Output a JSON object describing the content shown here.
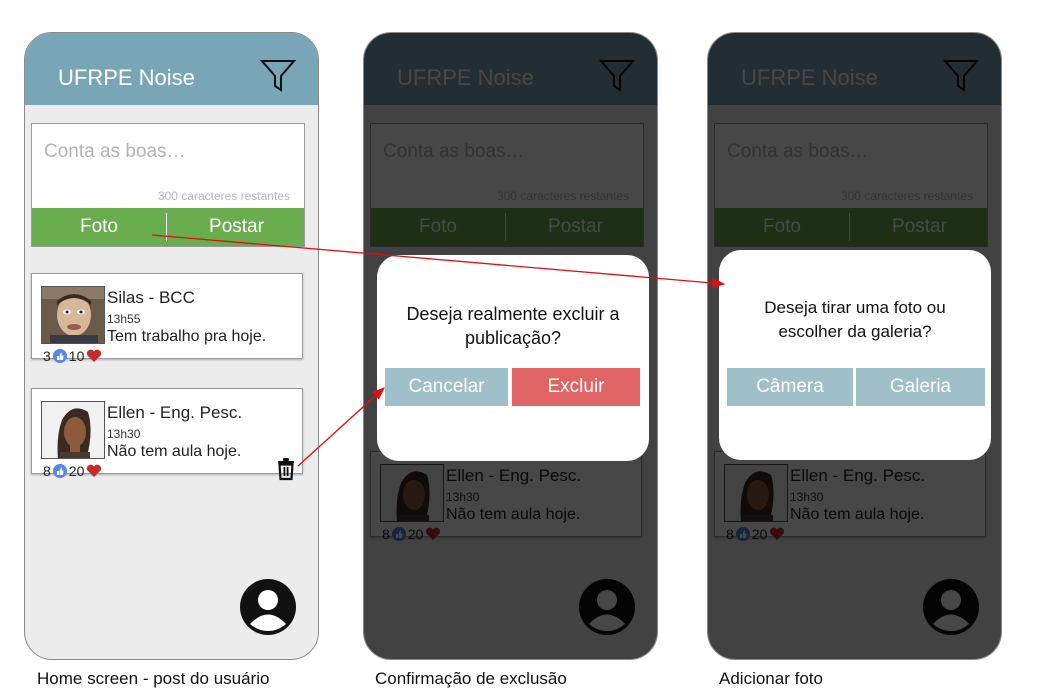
{
  "app": {
    "title": "UFRPE Noise"
  },
  "composer": {
    "placeholder": "Conta as boas…",
    "counter": "300 caracteres restantes",
    "photo_label": "Foto",
    "post_label": "Postar"
  },
  "posts": [
    {
      "name": "Silas - BCC",
      "time": "13h55",
      "text": "Tem trabalho pra hoje.",
      "likes": "3",
      "hearts": "10"
    },
    {
      "name": "Ellen - Eng. Pesc.",
      "time": "13h30",
      "text": "Não tem aula hoje.",
      "likes": "8",
      "hearts": "20"
    }
  ],
  "dialog_delete": {
    "message_line1": "Deseja realmente excluir a",
    "message_line2": "publicação?",
    "cancel_label": "Cancelar",
    "confirm_label": "Excluir"
  },
  "dialog_photo": {
    "message_line1": "Deseja tirar uma foto ou",
    "message_line2": "escolher da galeria?",
    "camera_label": "Câmera",
    "gallery_label": "Galeria"
  },
  "captions": {
    "screen1": "Home screen - post do usuário",
    "screen2": "Confirmação de exclusão",
    "screen3": "Adicionar foto"
  },
  "colors": {
    "header": "#79a6b6",
    "action_bar": "#6aad4e",
    "delete_button": "#e06464",
    "neutral_button": "#9fc0c8",
    "arrow": "#e01010"
  }
}
